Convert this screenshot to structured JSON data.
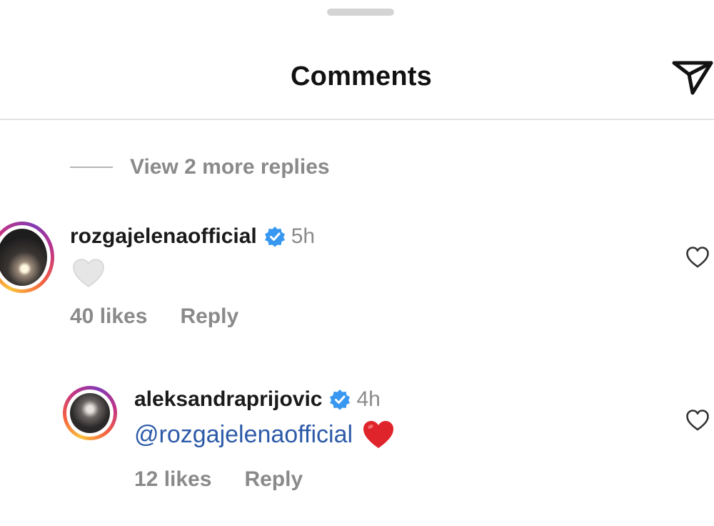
{
  "header": {
    "title": "Comments",
    "share_icon": "send-icon"
  },
  "thread": {
    "view_more_replies": "View 2 more replies"
  },
  "comments": [
    {
      "username": "rozgajelenaofficial",
      "verified": true,
      "time": "5h",
      "text_emoji": "white-heart",
      "likes": "40 likes",
      "reply": "Reply"
    },
    {
      "username": "aleksandraprijovic",
      "verified": true,
      "time": "4h",
      "mention": "@rozgajelenaofficial",
      "text_emoji": "red-heart",
      "likes": "12 likes",
      "reply": "Reply"
    }
  ],
  "colors": {
    "verified_blue": "#3897f0",
    "mention_blue": "#2d5aa8",
    "muted_text": "#8a8a8a",
    "heart_red": "#e0242b"
  }
}
